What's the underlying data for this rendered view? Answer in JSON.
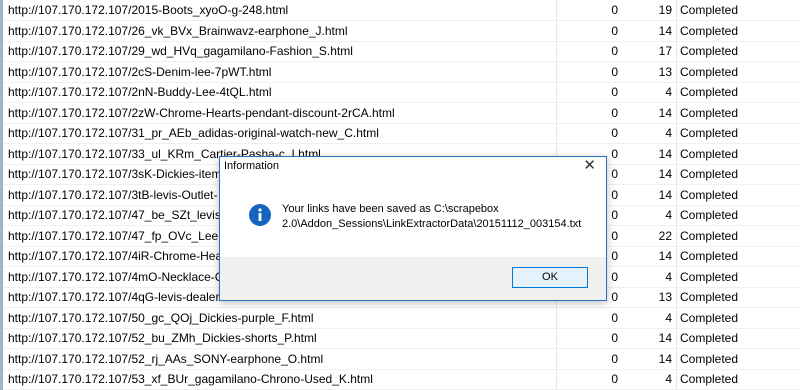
{
  "rows": [
    {
      "url": "http://107.170.172.107/2015-Boots_xyoO-g-248.html",
      "col1": "0",
      "col2": "19",
      "status": "Completed"
    },
    {
      "url": "http://107.170.172.107/26_vk_BVx_Brainwavz-earphone_J.html",
      "col1": "0",
      "col2": "14",
      "status": "Completed"
    },
    {
      "url": "http://107.170.172.107/29_wd_HVq_gagamilano-Fashion_S.html",
      "col1": "0",
      "col2": "17",
      "status": "Completed"
    },
    {
      "url": "http://107.170.172.107/2cS-Denim-lee-7pWT.html",
      "col1": "0",
      "col2": "13",
      "status": "Completed"
    },
    {
      "url": "http://107.170.172.107/2nN-Buddy-Lee-4tQL.html",
      "col1": "0",
      "col2": "4",
      "status": "Completed"
    },
    {
      "url": "http://107.170.172.107/2zW-Chrome-Hearts-pendant-discount-2rCA.html",
      "col1": "0",
      "col2": "14",
      "status": "Completed"
    },
    {
      "url": "http://107.170.172.107/31_pr_AEb_adidas-original-watch-new_C.html",
      "col1": "0",
      "col2": "4",
      "status": "Completed"
    },
    {
      "url": "http://107.170.172.107/33_ul_KRm_Cartier-Pasha-c_I.html",
      "col1": "0",
      "col2": "14",
      "status": "Completed"
    },
    {
      "url": "http://107.170.172.107/3sK-Dickies-item",
      "col1": "0",
      "col2": "14",
      "status": "Completed"
    },
    {
      "url": "http://107.170.172.107/3tB-levis-Outlet-",
      "col1": "0",
      "col2": "14",
      "status": "Completed"
    },
    {
      "url": "http://107.170.172.107/47_be_SZt_levis",
      "col1": "0",
      "col2": "4",
      "status": "Completed"
    },
    {
      "url": "http://107.170.172.107/47_fp_OVc_Lee",
      "col1": "0",
      "col2": "22",
      "status": "Completed"
    },
    {
      "url": "http://107.170.172.107/4iR-Chrome-Hea",
      "col1": "0",
      "col2": "14",
      "status": "Completed"
    },
    {
      "url": "http://107.170.172.107/4mO-Necklace-C",
      "col1": "0",
      "col2": "4",
      "status": "Completed"
    },
    {
      "url": "http://107.170.172.107/4qG-levis-dealer-",
      "col1": "0",
      "col2": "13",
      "status": "Completed"
    },
    {
      "url": "http://107.170.172.107/50_gc_QOj_Dickies-purple_F.html",
      "col1": "0",
      "col2": "4",
      "status": "Completed"
    },
    {
      "url": "http://107.170.172.107/52_bu_ZMh_Dickies-shorts_P.html",
      "col1": "0",
      "col2": "14",
      "status": "Completed"
    },
    {
      "url": "http://107.170.172.107/52_rj_AAs_SONY-earphone_O.html",
      "col1": "0",
      "col2": "14",
      "status": "Completed"
    },
    {
      "url": "http://107.170.172.107/53_xf_BUr_gagamilano-Chrono-Used_K.html",
      "col1": "0",
      "col2": "4",
      "status": "Completed"
    }
  ],
  "dialog": {
    "title": "Information",
    "close_label": "✕",
    "icon": "info-icon",
    "message": "Your links have been saved as C:\\scrapebox 2.0\\Addon_Sessions\\LinkExtractorData\\20151112_003154.txt",
    "ok_label": "OK"
  },
  "colors": {
    "accent": "#0078d7",
    "info_icon": "#1565c0",
    "dialog_border": "#2b6fb6",
    "footer": "#f0f0f0"
  }
}
